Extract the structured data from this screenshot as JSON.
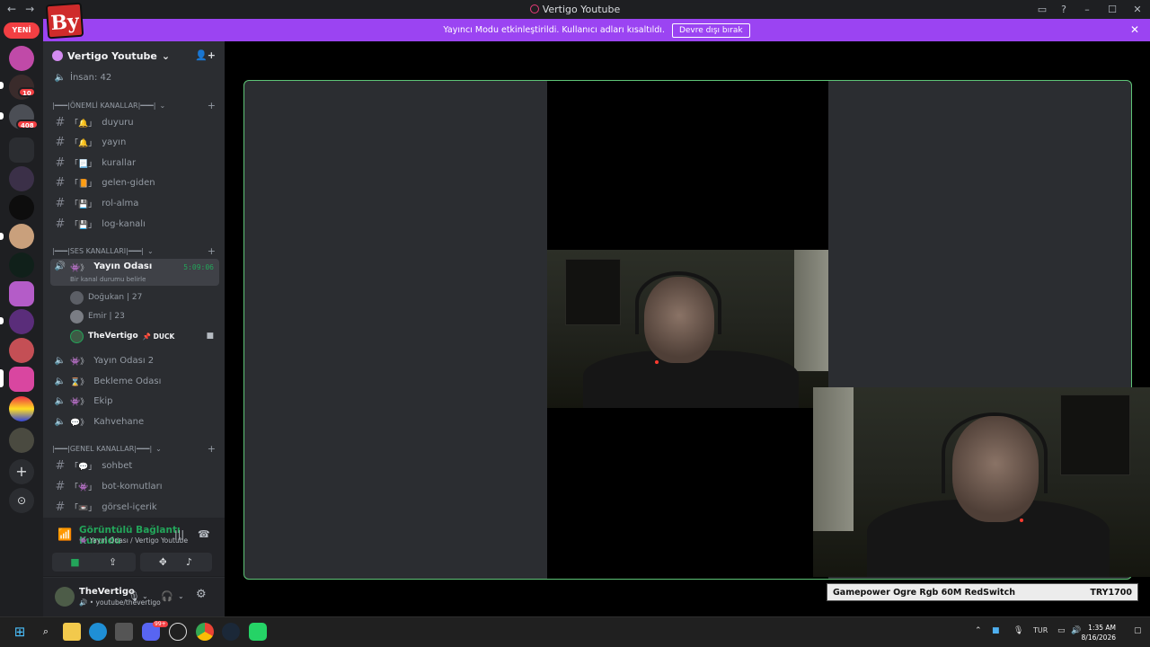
{
  "window": {
    "title": "Vertigo Youtube",
    "back_label": "←",
    "forward_label": "→",
    "inbox_icon": "inbox-icon",
    "help_label": "?",
    "minimize_label": "–",
    "maximize_label": "☐",
    "close_label": "✕"
  },
  "overlay_logo": "By",
  "banner": {
    "message": "Yayıncı Modu etkinleştirildi. Kullanıcı adları kısaltıldı.",
    "button_label": "Devre dışı bırak",
    "close_label": "✕"
  },
  "rail": {
    "new_label": "YENİ",
    "badges": [
      "10",
      "408"
    ],
    "add_label": "+",
    "discover_label": "⊙"
  },
  "server": {
    "name": "Vertigo Youtube",
    "chevron": "⌄",
    "invite_label": "👤+",
    "people_count": "İnsan: 42"
  },
  "categories": {
    "important": "|━━━|ÖNEMLİ KANALLAR|━━━|",
    "voice": "|━━━|SES KANALLARI|━━━|",
    "general": "|━━━|GENEL KANALLAR|━━━|",
    "chevron": "⌄",
    "plus": "+"
  },
  "text_channels_important": [
    {
      "emoji": "「🔔」",
      "name": "duyuru"
    },
    {
      "emoji": "「🔔」",
      "name": "yayın"
    },
    {
      "emoji": "「📃」",
      "name": "kurallar"
    },
    {
      "emoji": "「📙」",
      "name": "gelen-giden"
    },
    {
      "emoji": "「💾」",
      "name": "rol-alma"
    },
    {
      "emoji": "「💾」",
      "name": "log-kanalı"
    }
  ],
  "active_voice": {
    "emoji": "👾》",
    "name": "Yayın Odası",
    "timer": "5:09:06",
    "status_hint": "Bir kanal durumu belirle",
    "users": [
      {
        "name": "Doğukan | 27"
      },
      {
        "name": "Emir | 23"
      },
      {
        "name": "TheVertigo",
        "tag": "📌 DUCK"
      }
    ]
  },
  "voice_channels": [
    {
      "emoji": "👾》",
      "name": "Yayın Odası 2"
    },
    {
      "emoji": "⌛》",
      "name": "Bekleme Odası"
    },
    {
      "emoji": "👾》",
      "name": "Ekip"
    },
    {
      "emoji": "💬》",
      "name": "Kahvehane"
    }
  ],
  "text_channels_general": [
    {
      "emoji": "「💬」",
      "name": "sohbet"
    },
    {
      "emoji": "「👾」",
      "name": "bot-komutları"
    },
    {
      "emoji": "「📼」",
      "name": "görsel-içerik"
    }
  ],
  "voice_panel": {
    "status": "Görüntülü Bağlantı Kuruldu",
    "location": "👾 Yayın Odası / Vertigo Youtube",
    "noise_label": "|||",
    "disconnect_label": "☎",
    "camera_label": "■",
    "screen_label": "⇪",
    "activity_label": "✥",
    "soundboard_label": "♪"
  },
  "user_panel": {
    "name": "TheVertigo",
    "sub": "🔊 • youtube/thevertigo",
    "mic_label": "🎙",
    "headset_label": "🎧",
    "settings_label": "⚙"
  },
  "ticker": {
    "product": "Gamepower Ogre Rgb 60M RedSwitch",
    "price": "TRY1700"
  },
  "taskbar": {
    "lang": "TUR",
    "time": "1:35 AM",
    "date": "8/16/2026",
    "discord_badge": "99+"
  },
  "colors": {
    "accent_green": "#23a55a",
    "banner_purple": "#9b44f2",
    "badge_red": "#f23f43"
  }
}
